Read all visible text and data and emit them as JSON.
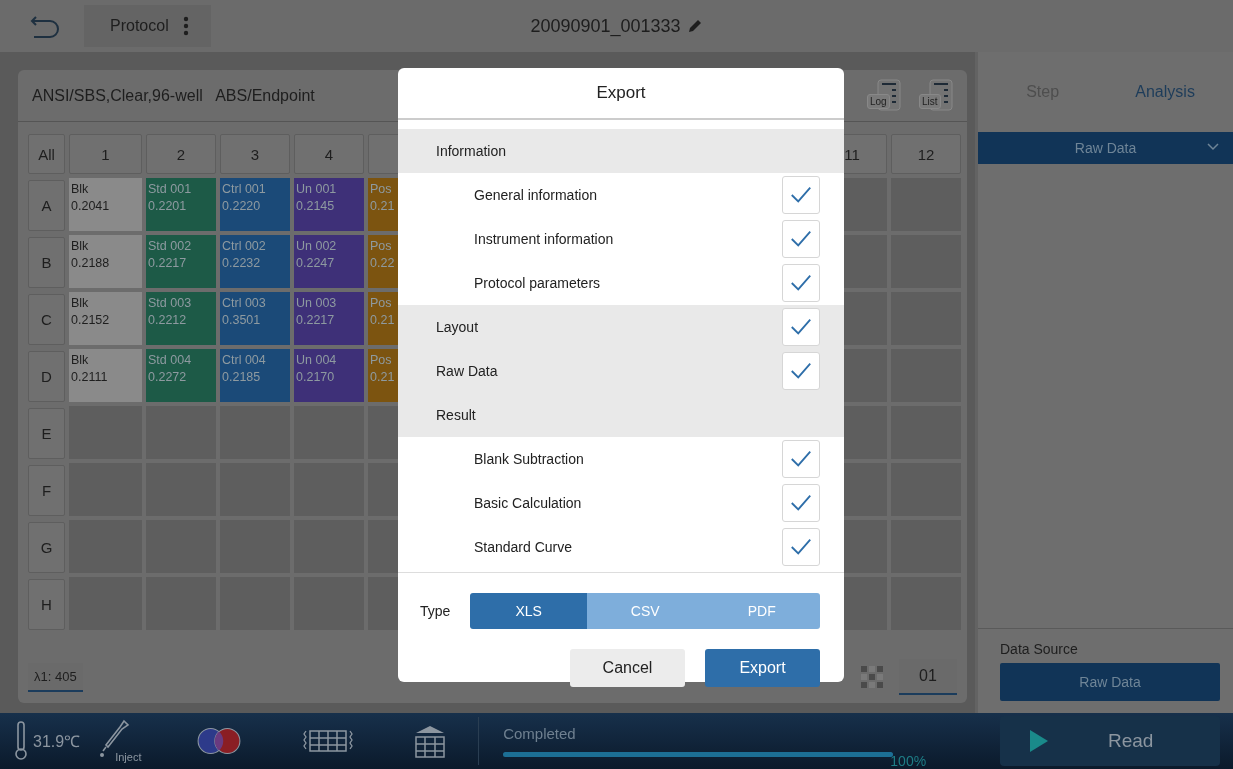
{
  "top_bar": {
    "protocol_button": "Protocol",
    "title": "20090901_001333"
  },
  "plate_panel": {
    "header": "ANSI/SBS,Clear,96-well   ABS/Endpoint",
    "log_button": "Log",
    "list_button": "List",
    "corner": "All",
    "left_columns": [
      "1",
      "2",
      "3",
      "4"
    ],
    "right_columns": [
      "11",
      "12"
    ],
    "rows": [
      {
        "label": "A",
        "left_cells": [
          {
            "kind": "blank",
            "name": "Blk",
            "value": "0.2041"
          },
          {
            "kind": "sample",
            "name": "Std 001",
            "value": "0.2201",
            "color": "#1d5a47"
          },
          {
            "kind": "sample",
            "name": "Ctrl 001",
            "value": "0.2220",
            "color": "#1b4a78"
          },
          {
            "kind": "sample",
            "name": "Un 001",
            "value": "0.2145",
            "color": "#3e3078"
          },
          {
            "kind": "sample",
            "name": "Pos",
            "value": "0.21",
            "color": "#7c5410"
          }
        ],
        "right_cells": [
          {
            "kind": "empty"
          },
          {
            "kind": "empty"
          }
        ]
      },
      {
        "label": "B",
        "left_cells": [
          {
            "kind": "blank",
            "name": "Blk",
            "value": "0.2188"
          },
          {
            "kind": "sample",
            "name": "Std 002",
            "value": "0.2217",
            "color": "#1d5a47"
          },
          {
            "kind": "sample",
            "name": "Ctrl 002",
            "value": "0.2232",
            "color": "#1b4a78"
          },
          {
            "kind": "sample",
            "name": "Un 002",
            "value": "0.2247",
            "color": "#3e3078"
          },
          {
            "kind": "sample",
            "name": "Pos",
            "value": "0.22",
            "color": "#7c5410"
          }
        ],
        "right_cells": [
          {
            "kind": "empty"
          },
          {
            "kind": "empty"
          }
        ]
      },
      {
        "label": "C",
        "left_cells": [
          {
            "kind": "blank",
            "name": "Blk",
            "value": "0.2152"
          },
          {
            "kind": "sample",
            "name": "Std 003",
            "value": "0.2212",
            "color": "#1d5a47"
          },
          {
            "kind": "sample",
            "name": "Ctrl 003",
            "value": "0.3501",
            "color": "#1b4a78"
          },
          {
            "kind": "sample",
            "name": "Un 003",
            "value": "0.2217",
            "color": "#3e3078"
          },
          {
            "kind": "sample",
            "name": "Pos",
            "value": "0.21",
            "color": "#7c5410"
          }
        ],
        "right_cells": [
          {
            "kind": "empty"
          },
          {
            "kind": "empty"
          }
        ]
      },
      {
        "label": "D",
        "left_cells": [
          {
            "kind": "blank",
            "name": "Blk",
            "value": "0.2111"
          },
          {
            "kind": "sample",
            "name": "Std 004",
            "value": "0.2272",
            "color": "#1d5a47"
          },
          {
            "kind": "sample",
            "name": "Ctrl 004",
            "value": "0.2185",
            "color": "#1b4a78"
          },
          {
            "kind": "sample",
            "name": "Un 004",
            "value": "0.2170",
            "color": "#3e3078"
          },
          {
            "kind": "sample",
            "name": "Pos",
            "value": "0.21",
            "color": "#7c5410"
          }
        ],
        "right_cells": [
          {
            "kind": "empty"
          },
          {
            "kind": "empty"
          }
        ]
      },
      {
        "label": "E",
        "left_cells": [
          {
            "kind": "empty"
          },
          {
            "kind": "empty"
          },
          {
            "kind": "empty"
          },
          {
            "kind": "empty"
          },
          {
            "kind": "empty"
          }
        ],
        "right_cells": [
          {
            "kind": "empty"
          },
          {
            "kind": "empty"
          }
        ]
      },
      {
        "label": "F",
        "left_cells": [
          {
            "kind": "empty"
          },
          {
            "kind": "empty"
          },
          {
            "kind": "empty"
          },
          {
            "kind": "empty"
          },
          {
            "kind": "empty"
          }
        ],
        "right_cells": [
          {
            "kind": "empty"
          },
          {
            "kind": "empty"
          }
        ]
      },
      {
        "label": "G",
        "left_cells": [
          {
            "kind": "empty"
          },
          {
            "kind": "empty"
          },
          {
            "kind": "empty"
          },
          {
            "kind": "empty"
          },
          {
            "kind": "empty"
          }
        ],
        "right_cells": [
          {
            "kind": "empty"
          },
          {
            "kind": "empty"
          }
        ]
      },
      {
        "label": "H",
        "left_cells": [
          {
            "kind": "empty"
          },
          {
            "kind": "empty"
          },
          {
            "kind": "empty"
          },
          {
            "kind": "empty"
          },
          {
            "kind": "empty"
          }
        ],
        "right_cells": [
          {
            "kind": "empty"
          },
          {
            "kind": "empty"
          }
        ]
      }
    ],
    "wavelength_tab": "λ1: 405",
    "plate_number_tab": "01"
  },
  "side_panel": {
    "tabs": [
      {
        "label": "Step",
        "selected": false
      },
      {
        "label": "Analysis",
        "selected": true
      }
    ],
    "dropdown": "Raw Data",
    "data_source_label": "Data Source",
    "data_source_button": "Raw Data"
  },
  "bottom_bar": {
    "temperature": "31.9℃",
    "inject": "Inject",
    "status": "Completed",
    "progress": {
      "level": 1,
      "reading": "100%"
    },
    "read_button": "Read"
  },
  "dialog": {
    "title": "Export",
    "sections": [
      {
        "kind": "group",
        "label": "Information",
        "children": [
          {
            "label": "General information",
            "checked": true
          },
          {
            "label": "Instrument information",
            "checked": true
          },
          {
            "label": "Protocol parameters",
            "checked": true
          }
        ]
      },
      {
        "kind": "check",
        "label": "Layout",
        "checked": true
      },
      {
        "kind": "check",
        "label": "Raw Data",
        "checked": true
      },
      {
        "kind": "group",
        "label": "Result",
        "children": [
          {
            "label": "Blank Subtraction",
            "checked": true
          },
          {
            "label": "Basic Calculation",
            "checked": true
          },
          {
            "label": "Standard Curve",
            "checked": true
          }
        ]
      }
    ],
    "type_label": "Type",
    "types": [
      {
        "label": "XLS",
        "selected": true
      },
      {
        "label": "CSV",
        "selected": false
      },
      {
        "label": "PDF",
        "selected": false
      }
    ],
    "buttons": [
      {
        "kind": "secondary",
        "label": "Cancel"
      },
      {
        "kind": "primary",
        "label": "Export"
      }
    ]
  }
}
